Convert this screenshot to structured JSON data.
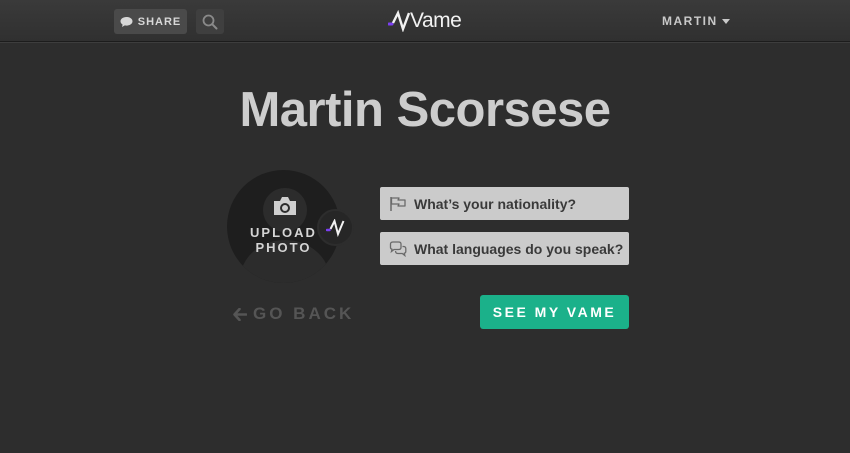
{
  "header": {
    "share_label": "SHARE",
    "logo_text": "Vame",
    "user_name": "MARTIN",
    "icons": [
      "speech-bubble-icon",
      "search-icon",
      "vame-logo-icon",
      "caret-down-icon"
    ]
  },
  "profile": {
    "name": "Martin Scorsese",
    "upload_label_line1": "UPLOAD",
    "upload_label_line2": "PHOTO"
  },
  "questions": [
    {
      "label": "What’s your nationality?",
      "icon": "flag-icon"
    },
    {
      "label": "What languages do you speak?",
      "icon": "chat-bubbles-icon"
    }
  ],
  "actions": {
    "go_back_label": "GO BACK",
    "cta_label": "SEE MY VAME"
  },
  "colors": {
    "background": "#2d2d2d",
    "accent_green": "#1bb18a",
    "logo_purple": "#7b3ff2",
    "field_bg": "#cbcbcb"
  }
}
